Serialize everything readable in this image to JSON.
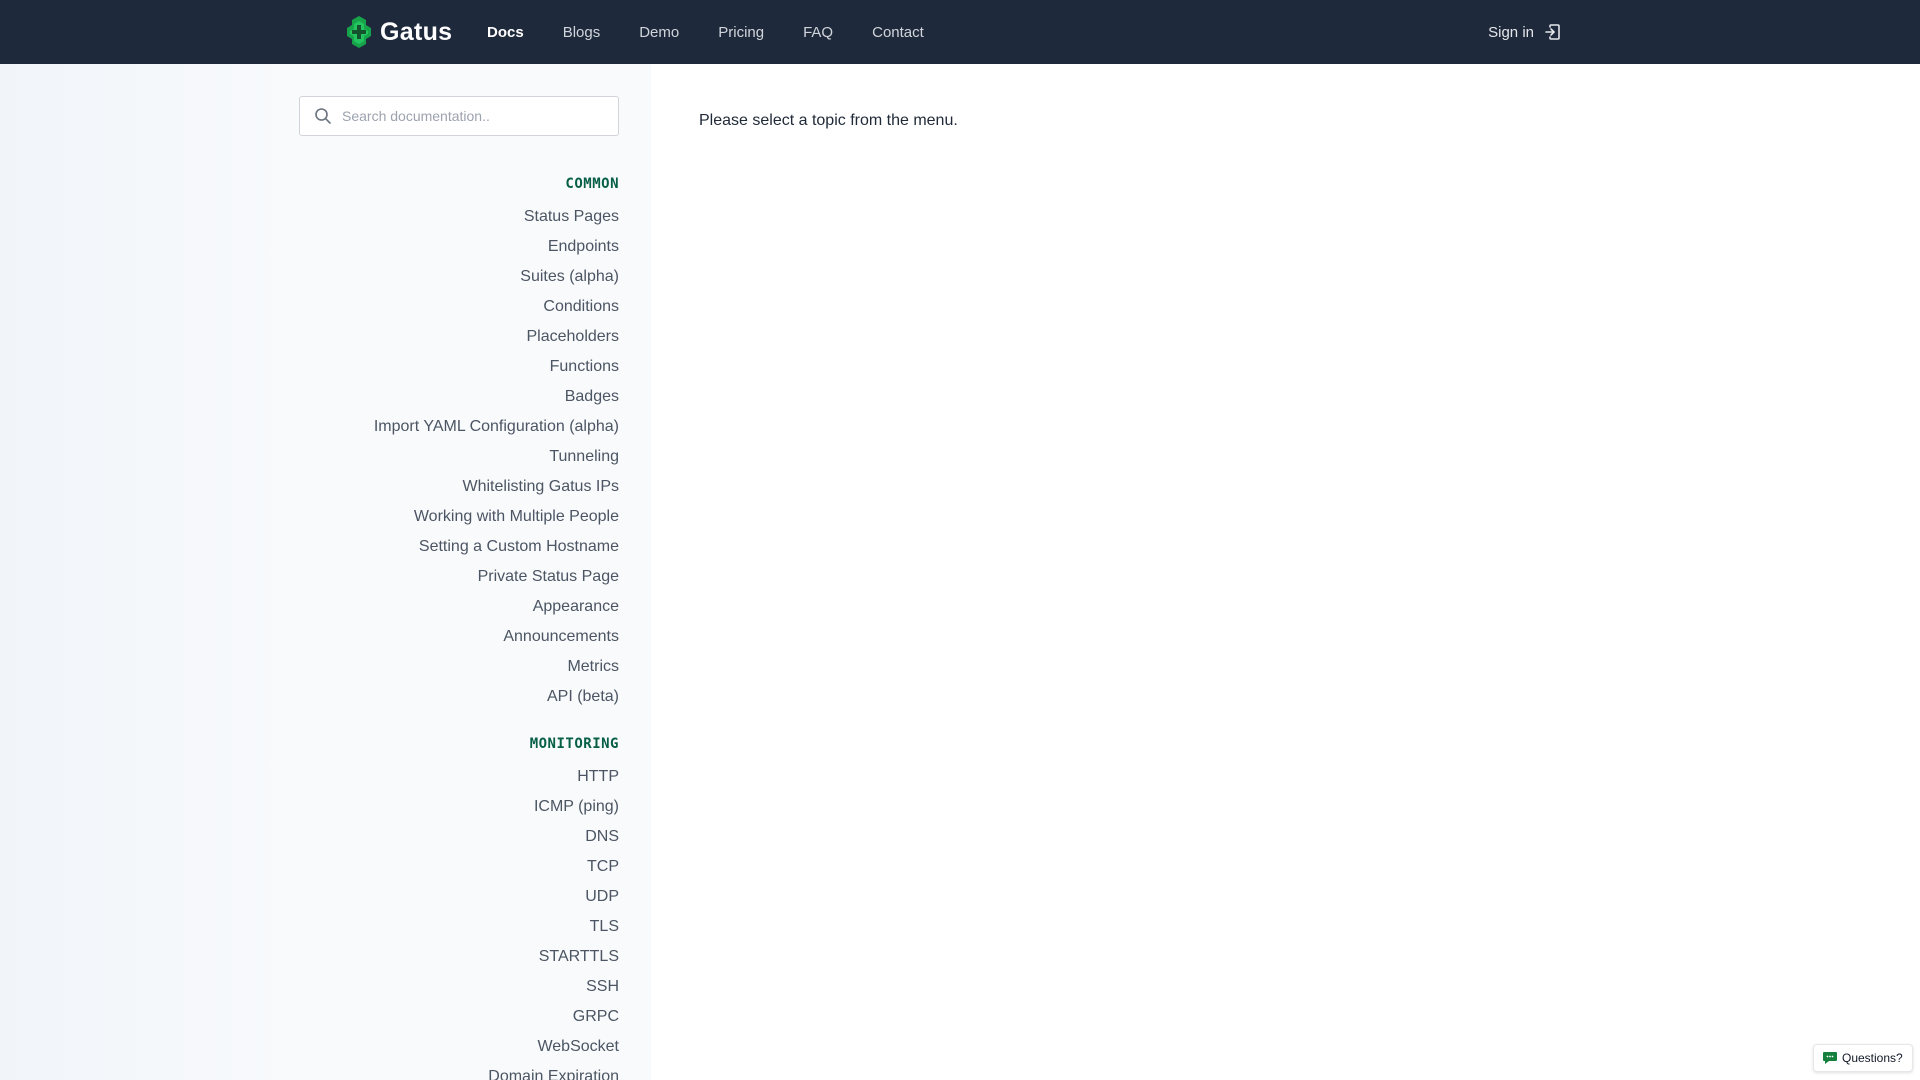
{
  "header": {
    "logo_text": "Gatus",
    "nav": [
      {
        "label": "Docs",
        "active": true
      },
      {
        "label": "Blogs"
      },
      {
        "label": "Demo"
      },
      {
        "label": "Pricing"
      },
      {
        "label": "FAQ"
      },
      {
        "label": "Contact"
      }
    ],
    "signin_label": "Sign in",
    "signin_icon": "sign-in-icon"
  },
  "sidebar": {
    "search": {
      "placeholder": "Search documentation..",
      "value": "",
      "icon": "search-icon"
    },
    "sections": [
      {
        "title": "COMMON",
        "items": [
          "Status Pages",
          "Endpoints",
          "Suites (alpha)",
          "Conditions",
          "Placeholders",
          "Functions",
          "Badges",
          "Import YAML Configuration (alpha)",
          "Tunneling",
          "Whitelisting Gatus IPs",
          "Working with Multiple People",
          "Setting a Custom Hostname",
          "Private Status Page",
          "Appearance",
          "Announcements",
          "Metrics",
          "API (beta)"
        ]
      },
      {
        "title": "MONITORING",
        "items": [
          "HTTP",
          "ICMP (ping)",
          "DNS",
          "TCP",
          "UDP",
          "TLS",
          "STARTTLS",
          "SSH",
          "GRPC",
          "WebSocket",
          "Domain Expiration"
        ]
      }
    ]
  },
  "main": {
    "message": "Please select a topic from the menu."
  },
  "widget": {
    "label": "Questions?",
    "icon": "chat-bubble-icon"
  },
  "colors": {
    "header_bg": "#1e293b",
    "accent_green": "#16a34a",
    "section_title": "#065f46"
  }
}
